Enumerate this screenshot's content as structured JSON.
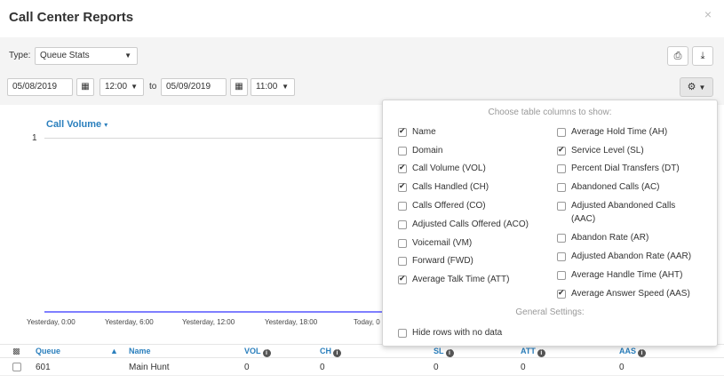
{
  "header": {
    "title": "Call Center Reports",
    "close": "×"
  },
  "toolbar": {
    "type_label": "Type:",
    "type_value": "Queue Stats",
    "start_date": "05/08/2019",
    "start_time": "12:00",
    "to_label": "to",
    "end_date": "05/09/2019",
    "end_time": "11:00",
    "print_icon": "print-icon",
    "download_icon": "download-icon",
    "settings_icon": "gear-icon"
  },
  "chart": {
    "title": "Call Volume",
    "y_top": "1",
    "x_ticks": [
      "Yesterday, 0:00",
      "Yesterday, 6:00",
      "Yesterday, 12:00",
      "Yesterday, 18:00",
      "Today, 0"
    ]
  },
  "columns_menu": {
    "header": "Choose table columns to show:",
    "left": [
      {
        "label": "Name",
        "checked": true
      },
      {
        "label": "Domain",
        "checked": false
      },
      {
        "label": "Call Volume (VOL)",
        "checked": true
      },
      {
        "label": "Calls Handled (CH)",
        "checked": true
      },
      {
        "label": "Calls Offered (CO)",
        "checked": false
      },
      {
        "label": "Adjusted Calls Offered (ACO)",
        "checked": false
      },
      {
        "label": "Voicemail (VM)",
        "checked": false
      },
      {
        "label": "Forward (FWD)",
        "checked": false
      },
      {
        "label": "Average Talk Time (ATT)",
        "checked": true
      }
    ],
    "right": [
      {
        "label": "Average Hold Time (AH)",
        "checked": false
      },
      {
        "label": "Service Level (SL)",
        "checked": true
      },
      {
        "label": "Percent Dial Transfers (DT)",
        "checked": false
      },
      {
        "label": "Abandoned Calls (AC)",
        "checked": false
      },
      {
        "label": "Adjusted Abandoned Calls",
        "label2": "(AAC)",
        "checked": false
      },
      {
        "label": "Abandon Rate (AR)",
        "checked": false
      },
      {
        "label": "Adjusted Abandon Rate (AAR)",
        "checked": false
      },
      {
        "label": "Average Handle Time (AHT)",
        "checked": false
      },
      {
        "label": "Average Answer Speed (AAS)",
        "checked": true
      }
    ],
    "general_header": "General Settings:",
    "hide_rows": {
      "label": "Hide rows with no data",
      "checked": false
    }
  },
  "table": {
    "headers": {
      "queue": "Queue",
      "name": "Name",
      "vol": "VOL",
      "ch": "CH",
      "sl": "SL",
      "att": "ATT",
      "aas": "AAS"
    },
    "rows": [
      {
        "queue": "601",
        "name": "Main Hunt",
        "vol": "0",
        "ch": "0",
        "sl": "0",
        "att": "0",
        "aas": "0"
      }
    ]
  },
  "colors": {
    "accent": "#2a7fbd",
    "line": "#7f7fff"
  }
}
